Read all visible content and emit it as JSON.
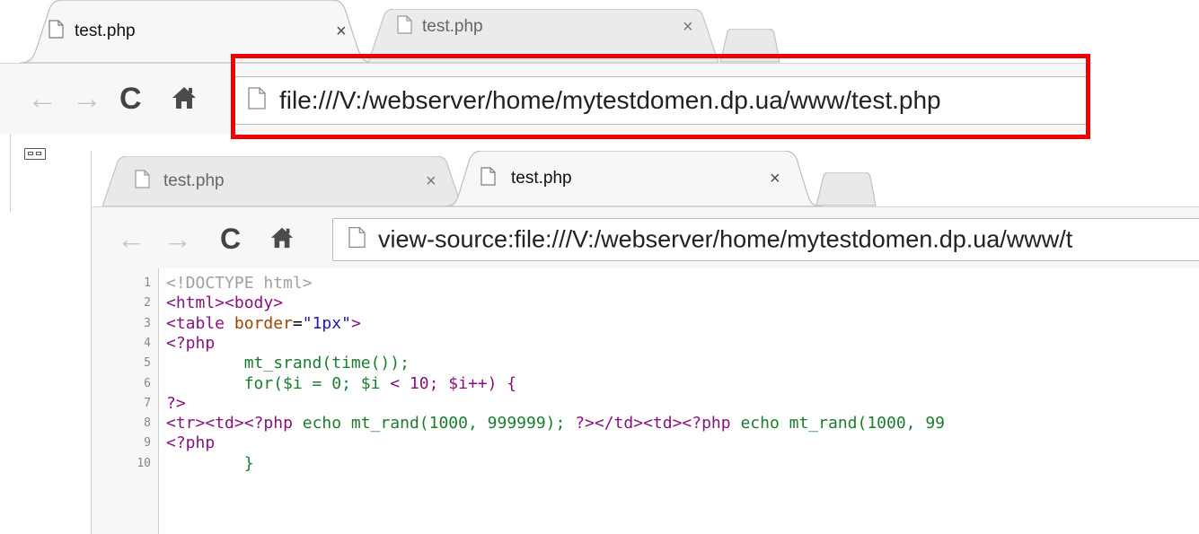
{
  "window_back": {
    "tabs": [
      {
        "title": "test.php",
        "active": true,
        "close": "×"
      },
      {
        "title": "test.php",
        "active": false,
        "close": "×"
      }
    ],
    "nav": {
      "back": "←",
      "forward": "→",
      "reload": "C",
      "home": "home-icon"
    },
    "url": "file:///V:/webserver/home/mytestdomen.dp.ua/www/test.php",
    "highlight_color": "#ee0000"
  },
  "window_front": {
    "tabs": [
      {
        "title": "test.php",
        "active": false,
        "close": "×"
      },
      {
        "title": "test.php",
        "active": true,
        "close": "×"
      }
    ],
    "nav": {
      "back": "←",
      "forward": "→",
      "reload": "C",
      "home": "home-icon"
    },
    "url": "view-source:file:///V:/webserver/home/mytestdomen.dp.ua/www/t"
  },
  "source_lines": [
    {
      "n": "1",
      "text": "<!DOCTYPE html>"
    },
    {
      "n": "2",
      "text": "<html><body>"
    },
    {
      "n": "3",
      "text": "<table border=\"1px\">"
    },
    {
      "n": "4",
      "text": "<?php"
    },
    {
      "n": "5",
      "text": "        mt_srand(time());"
    },
    {
      "n": "6",
      "text": "        for($i = 0; $i < 10; $i++) {"
    },
    {
      "n": "7",
      "text": "?>"
    },
    {
      "n": "8",
      "text": "<tr><td><?php echo mt_rand(1000, 999999); ?></td><td><?php echo mt_rand(1000, 99"
    },
    {
      "n": "9",
      "text": "<?php"
    },
    {
      "n": "10",
      "text": "        }"
    }
  ]
}
